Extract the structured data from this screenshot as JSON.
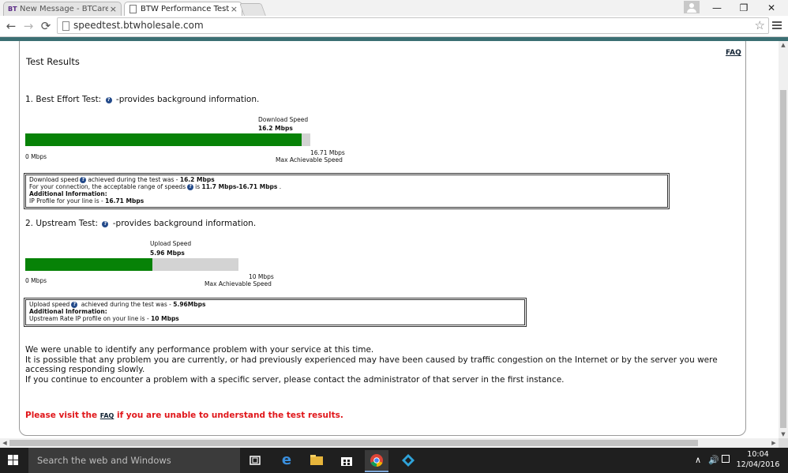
{
  "browser": {
    "tabs": [
      {
        "label": "New Message - BTCare Cc",
        "favicon": "BT",
        "active": false
      },
      {
        "label": "BTW Performance Test",
        "active": true
      }
    ],
    "tab_close": "×",
    "window_controls": {
      "minimize": "—",
      "restore": "❐",
      "close": "✕"
    },
    "nav": {
      "back": "←",
      "forward": "→",
      "reload": "⟳"
    },
    "url": "speedtest.btwholesale.com",
    "star": "☆"
  },
  "page": {
    "faq_top": "FAQ",
    "title": "Test Results",
    "best_effort": {
      "title_prefix": "1. Best Effort Test:",
      "title_suffix": " -provides background information.",
      "speed_label": "Download Speed",
      "speed_value": "16.2 Mbps",
      "min_label": "0 Mbps",
      "max_value": "16.71 Mbps",
      "max_label": "Max Achievable Speed",
      "fill_fraction": 0.9695,
      "info": {
        "line1_pre": "Download speed",
        "line1_mid": "achieved during the test was - ",
        "line1_val": "16.2 Mbps",
        "line2_pre": "For your connection, the acceptable range of speeds",
        "line2_mid": "is ",
        "line2_val": "11.7 Mbps-16.71 Mbps",
        "line2_end": " .",
        "line3": "Additional Information:",
        "line4_pre": "IP Profile for your line is - ",
        "line4_val": "16.71 Mbps"
      }
    },
    "upstream": {
      "title_prefix": "2. Upstream Test:",
      "title_suffix": " -provides background information.",
      "speed_label": "Upload Speed",
      "speed_value": "5.96 Mbps",
      "min_label": "0 Mbps",
      "max_value": "10 Mbps",
      "max_label": "Max Achievable Speed",
      "fill_fraction": 0.596,
      "info": {
        "line1_pre": "Upload speed",
        "line1_mid": " achieved during the test was - ",
        "line1_val": "5.96Mbps",
        "line2": "Additional Information:",
        "line3_pre": "Upstream Rate IP profile on your line is - ",
        "line3_val": "10 Mbps"
      }
    },
    "message": [
      "We were unable to identify any performance problem with your service at this time.",
      "It is possible that any problem you are currently, or had previously experienced may have been caused by traffic congestion on the Internet or by the server you were accessing responding slowly.",
      "If you continue to encounter a problem with a specific server, please contact the administrator of that server in the first instance."
    ],
    "visit": {
      "pre": "Please visit the ",
      "link": "FAQ",
      "post": " if you are unable to understand the test results."
    },
    "colors": {
      "bar_fill": "#078207",
      "bar_track": "#d3d3d3",
      "alert": "#e0161a",
      "teal": "#3b6f73"
    }
  },
  "taskbar": {
    "search_placeholder": "Search the web and Windows",
    "time": "10:04",
    "date": "12/04/2016",
    "icons": [
      "task-view-icon",
      "edge-icon",
      "file-explorer-icon",
      "store-icon",
      "chrome-icon",
      "kodi-icon"
    ]
  }
}
